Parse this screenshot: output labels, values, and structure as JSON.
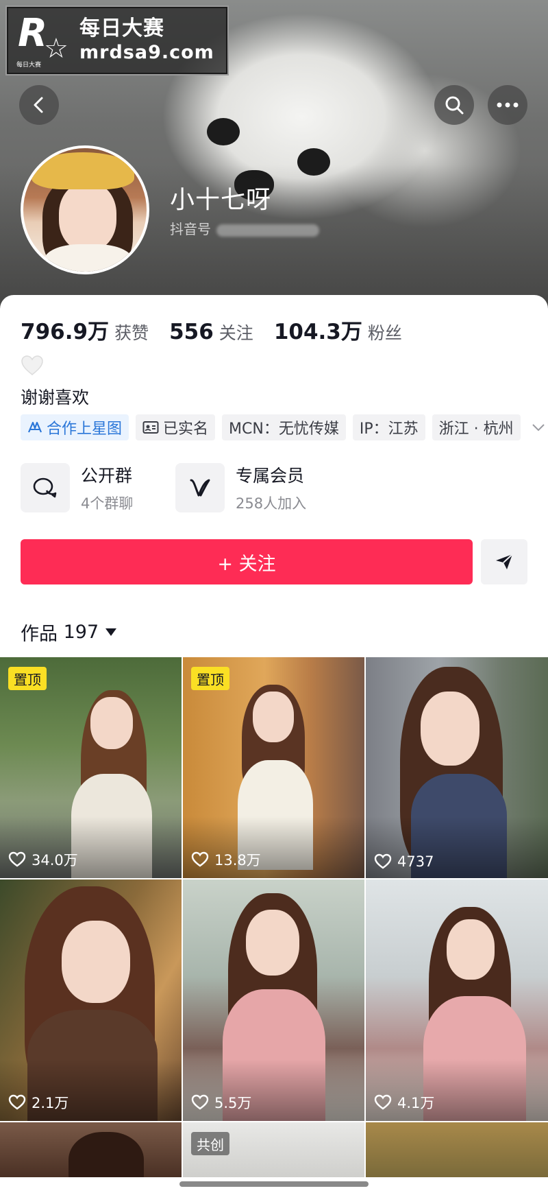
{
  "watermark": {
    "logo_small": "每日大赛",
    "title": "每日大赛",
    "url": "mrdsa9.com"
  },
  "header": {
    "back_icon": "chevron-left-icon",
    "search_icon": "search-icon",
    "more_icon": "more-dots-icon"
  },
  "profile": {
    "name": "小十七呀",
    "id_prefix": "抖音号"
  },
  "stats": [
    {
      "num": "796.9万",
      "label": "获赞"
    },
    {
      "num": "556",
      "label": "关注"
    },
    {
      "num": "104.3万",
      "label": "粉丝"
    }
  ],
  "bio": {
    "emoji": "white-heart-icon",
    "text": "谢谢喜欢"
  },
  "tags": [
    {
      "label": "合作上星图",
      "icon": "star-map-icon",
      "color": "#2a76d8"
    },
    {
      "label": "已实名",
      "icon": "id-card-icon"
    },
    {
      "label": "MCN：无忧传媒"
    },
    {
      "label": "IP：江苏"
    },
    {
      "label": "浙江 · 杭州"
    }
  ],
  "features": [
    {
      "title": "公开群",
      "subtitle": "4个群聊",
      "icon": "chat-bubbles-icon"
    },
    {
      "title": "专属会员",
      "subtitle": "258人加入",
      "icon": "v-member-icon"
    }
  ],
  "actions": {
    "follow_label": "+ 关注",
    "follow_color": "#fe2c55",
    "share_icon": "send-icon"
  },
  "works": {
    "label": "作品",
    "count": "197"
  },
  "videos": [
    {
      "likes": "34.0万",
      "badge": "置顶"
    },
    {
      "likes": "13.8万",
      "badge": "置顶"
    },
    {
      "likes": "4737",
      "badge": ""
    },
    {
      "likes": "2.1万",
      "badge": ""
    },
    {
      "likes": "5.5万",
      "badge": ""
    },
    {
      "likes": "4.1万",
      "badge": ""
    },
    {
      "likes": "",
      "badge": ""
    },
    {
      "likes": "",
      "badge": "共创"
    },
    {
      "likes": "",
      "badge": ""
    }
  ]
}
